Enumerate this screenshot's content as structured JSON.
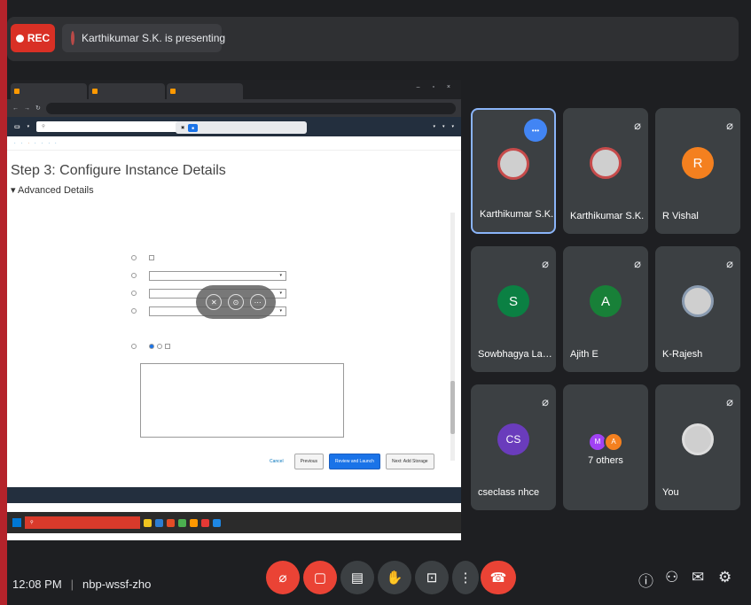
{
  "header": {
    "rec_label": "REC",
    "presenting_text": "Karthikumar S.K. is presenting"
  },
  "shared_screen": {
    "step_title": "Step 3: Configure Instance Details",
    "section_title": "Advanced Details",
    "buttons": {
      "cancel": "Cancel",
      "previous": "Previous",
      "review_launch": "Review and Launch",
      "next": "Next: Add Storage"
    }
  },
  "participants": [
    {
      "name": "Karthikumar S.K.",
      "avatar": "photo",
      "active": true
    },
    {
      "name": "Karthikumar S.K.",
      "avatar": "photo",
      "active": false
    },
    {
      "name": "R Vishal",
      "initial": "R",
      "color": "#f4801f"
    },
    {
      "name": "Sowbhagya Laks...",
      "initial": "S",
      "color": "#0b8043"
    },
    {
      "name": "Ajith E",
      "initial": "A",
      "color": "#188038"
    },
    {
      "name": "K-Rajesh",
      "avatar": "photo"
    },
    {
      "name": "cseclass nhce",
      "initial": "CS",
      "color": "#6a3cbc"
    },
    {
      "name": "7 others",
      "initials": [
        "M",
        "A"
      ]
    },
    {
      "name": "You",
      "avatar": "photo"
    }
  ],
  "footer": {
    "time": "12:08 PM",
    "meeting_code": "nbp-wssf-zho"
  },
  "colors": {
    "background": "#1e1f22",
    "tile": "#3c4043",
    "danger": "#ea4335",
    "active_border": "#8ab4f8"
  }
}
